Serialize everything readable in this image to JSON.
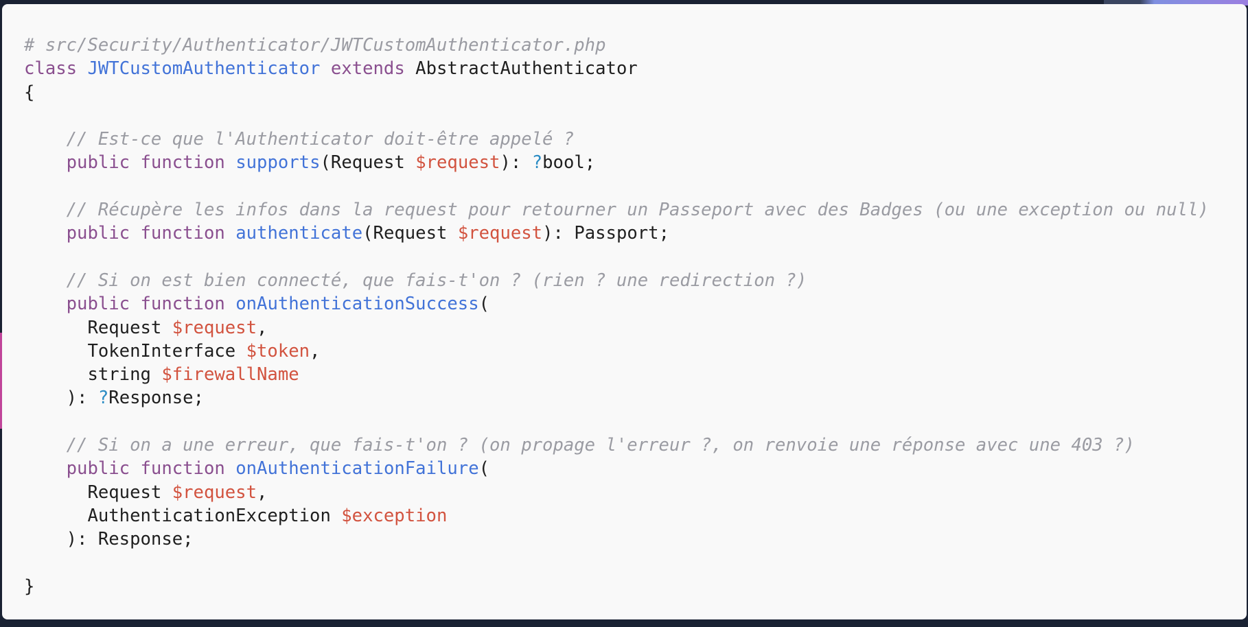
{
  "code": {
    "lines": [
      {
        "tokens": [
          {
            "t": "cm",
            "v": "# src/Security/Authenticator/JWTCustomAuthenticator.php"
          }
        ]
      },
      {
        "tokens": [
          {
            "t": "kw",
            "v": "class"
          },
          {
            "t": "tx",
            "v": " "
          },
          {
            "t": "fn",
            "v": "JWTCustomAuthenticator"
          },
          {
            "t": "tx",
            "v": " "
          },
          {
            "t": "kw",
            "v": "extends"
          },
          {
            "t": "tx",
            "v": " AbstractAuthenticator"
          }
        ]
      },
      {
        "tokens": [
          {
            "t": "tx",
            "v": "{"
          }
        ]
      },
      {
        "tokens": []
      },
      {
        "tokens": [
          {
            "t": "tx",
            "v": "    "
          },
          {
            "t": "cm",
            "v": "// Est-ce que l'Authenticator doit-être appelé ?"
          }
        ]
      },
      {
        "tokens": [
          {
            "t": "tx",
            "v": "    "
          },
          {
            "t": "kw",
            "v": "public"
          },
          {
            "t": "tx",
            "v": " "
          },
          {
            "t": "kw",
            "v": "function"
          },
          {
            "t": "tx",
            "v": " "
          },
          {
            "t": "fn",
            "v": "supports"
          },
          {
            "t": "tx",
            "v": "(Request "
          },
          {
            "t": "var",
            "v": "$request"
          },
          {
            "t": "tx",
            "v": "): "
          },
          {
            "t": "op",
            "v": "?"
          },
          {
            "t": "tx",
            "v": "bool;"
          }
        ]
      },
      {
        "tokens": []
      },
      {
        "tokens": [
          {
            "t": "tx",
            "v": "    "
          },
          {
            "t": "cm",
            "v": "// Récupère les infos dans la request pour retourner un Passeport avec des Badges (ou une exception ou null)"
          }
        ]
      },
      {
        "tokens": [
          {
            "t": "tx",
            "v": "    "
          },
          {
            "t": "kw",
            "v": "public"
          },
          {
            "t": "tx",
            "v": " "
          },
          {
            "t": "kw",
            "v": "function"
          },
          {
            "t": "tx",
            "v": " "
          },
          {
            "t": "fn",
            "v": "authenticate"
          },
          {
            "t": "tx",
            "v": "(Request "
          },
          {
            "t": "var",
            "v": "$request"
          },
          {
            "t": "tx",
            "v": "): Passport;"
          }
        ]
      },
      {
        "tokens": []
      },
      {
        "tokens": [
          {
            "t": "tx",
            "v": "    "
          },
          {
            "t": "cm",
            "v": "// Si on est bien connecté, que fais-t'on ? (rien ? une redirection ?)"
          }
        ]
      },
      {
        "tokens": [
          {
            "t": "tx",
            "v": "    "
          },
          {
            "t": "kw",
            "v": "public"
          },
          {
            "t": "tx",
            "v": " "
          },
          {
            "t": "kw",
            "v": "function"
          },
          {
            "t": "tx",
            "v": " "
          },
          {
            "t": "fn",
            "v": "onAuthenticationSuccess"
          },
          {
            "t": "tx",
            "v": "("
          }
        ]
      },
      {
        "tokens": [
          {
            "t": "tx",
            "v": "      Request "
          },
          {
            "t": "var",
            "v": "$request"
          },
          {
            "t": "tx",
            "v": ","
          }
        ]
      },
      {
        "tokens": [
          {
            "t": "tx",
            "v": "      TokenInterface "
          },
          {
            "t": "var",
            "v": "$token"
          },
          {
            "t": "tx",
            "v": ","
          }
        ]
      },
      {
        "tokens": [
          {
            "t": "tx",
            "v": "      string "
          },
          {
            "t": "var",
            "v": "$firewallName"
          }
        ]
      },
      {
        "tokens": [
          {
            "t": "tx",
            "v": "    ): "
          },
          {
            "t": "op",
            "v": "?"
          },
          {
            "t": "tx",
            "v": "Response;"
          }
        ]
      },
      {
        "tokens": []
      },
      {
        "tokens": [
          {
            "t": "tx",
            "v": "    "
          },
          {
            "t": "cm",
            "v": "// Si on a une erreur, que fais-t'on ? (on propage l'erreur ?, on renvoie une réponse avec une 403 ?)"
          }
        ]
      },
      {
        "tokens": [
          {
            "t": "tx",
            "v": "    "
          },
          {
            "t": "kw",
            "v": "public"
          },
          {
            "t": "tx",
            "v": " "
          },
          {
            "t": "kw",
            "v": "function"
          },
          {
            "t": "tx",
            "v": " "
          },
          {
            "t": "fn",
            "v": "onAuthenticationFailure"
          },
          {
            "t": "tx",
            "v": "("
          }
        ]
      },
      {
        "tokens": [
          {
            "t": "tx",
            "v": "      Request "
          },
          {
            "t": "var",
            "v": "$request"
          },
          {
            "t": "tx",
            "v": ","
          }
        ]
      },
      {
        "tokens": [
          {
            "t": "tx",
            "v": "      AuthenticationException "
          },
          {
            "t": "var",
            "v": "$exception"
          }
        ]
      },
      {
        "tokens": [
          {
            "t": "tx",
            "v": "    ): Response;"
          }
        ]
      },
      {
        "tokens": []
      },
      {
        "tokens": [
          {
            "t": "tx",
            "v": "}"
          }
        ]
      }
    ]
  },
  "colors": {
    "comment": "#9a9ba2",
    "keyword": "#8a4f8f",
    "function": "#4273d8",
    "variable": "#d2533f",
    "nullable": "#2b8cc4",
    "text": "#1f1f1f",
    "background": "#f9f9f9"
  }
}
